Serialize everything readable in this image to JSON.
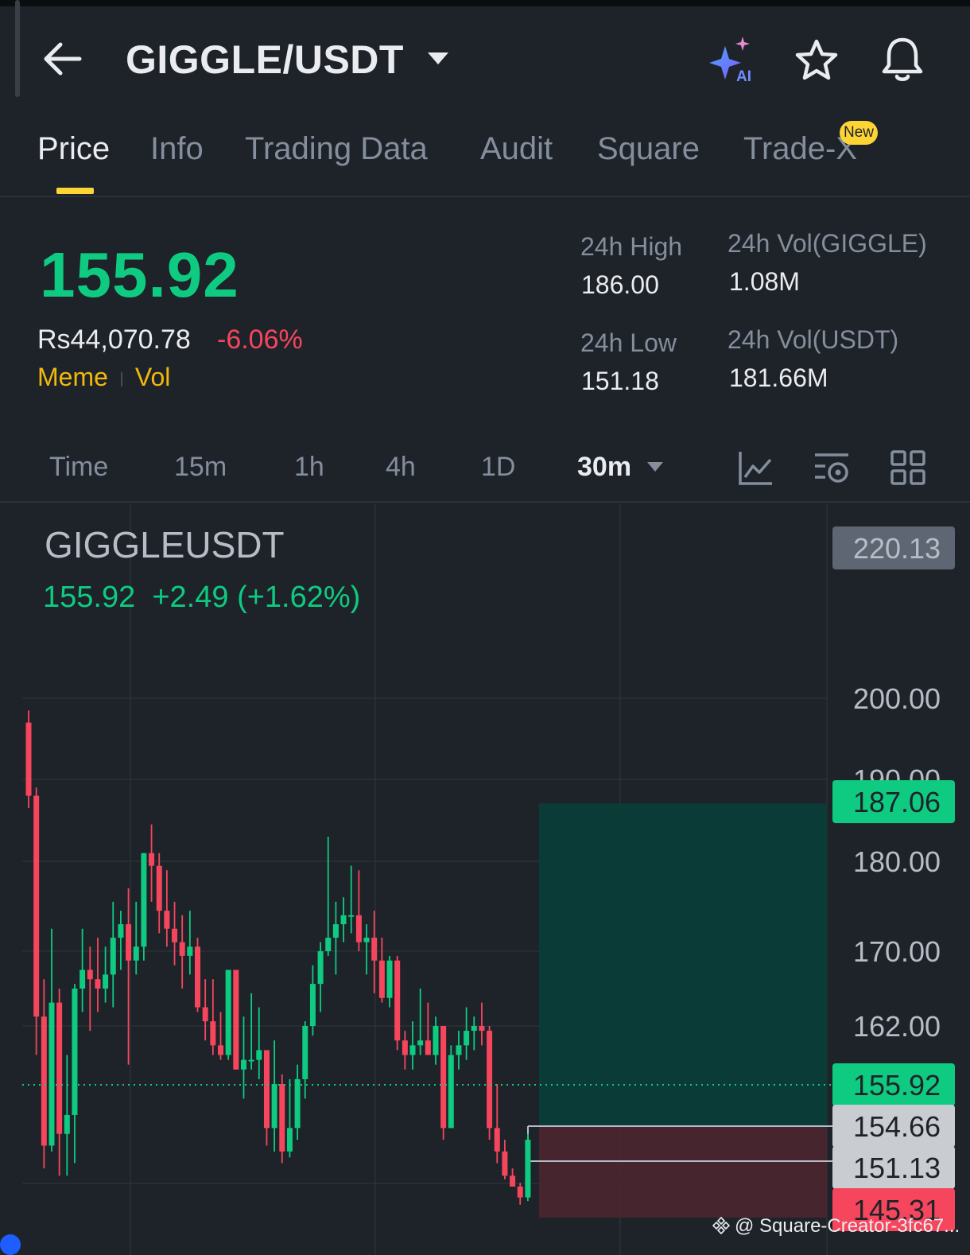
{
  "header": {
    "pair": "GIGGLE/USDT",
    "ai_label": "AI"
  },
  "tabs": [
    {
      "label": "Price",
      "active": true
    },
    {
      "label": "Info"
    },
    {
      "label": "Trading Data"
    },
    {
      "label": "Audit"
    },
    {
      "label": "Square"
    },
    {
      "label": "Trade-X",
      "badge": "New"
    }
  ],
  "ticker": {
    "last_price": "155.92",
    "fiat_price": "Rs44,070.78",
    "change_pct": "-6.06%",
    "tags": [
      "Meme",
      "Vol"
    ],
    "high_label": "24h High",
    "high_value": "186.00",
    "low_label": "24h Low",
    "low_value": "151.18",
    "vol_base_label": "24h Vol(GIGGLE)",
    "vol_base_value": "1.08M",
    "vol_quote_label": "24h Vol(USDT)",
    "vol_quote_value": "181.66M"
  },
  "intervals": {
    "items": [
      "Time",
      "15m",
      "1h",
      "4h",
      "1D"
    ],
    "active": "30m"
  },
  "chart": {
    "symbol": "GIGGLEUSDT",
    "last": "155.92",
    "change": "+2.49 (+1.62%)"
  },
  "watermark": "@ Square-Creator-3fc67...",
  "colors": {
    "background": "#1e2329",
    "up": "#0ecb81",
    "down": "#f6465d",
    "accent": "#fcd535",
    "muted": "#848e9c"
  },
  "chart_data": {
    "type": "candlestick",
    "interval": "30m",
    "y_axis_labels": [
      "220.13",
      "200.00",
      "190.00",
      "180.00",
      "170.00",
      "162.00"
    ],
    "price_tags": [
      {
        "label": "187.06",
        "kind": "take-profit",
        "color": "#0ecb81"
      },
      {
        "label": "155.92",
        "kind": "last-price",
        "color": "#0ecb81"
      },
      {
        "label": "154.66",
        "kind": "entry",
        "color": "#c9ccd1"
      },
      {
        "label": "151.13",
        "kind": "level",
        "color": "#c9ccd1"
      },
      {
        "label": "145.31",
        "kind": "stop-loss",
        "color": "#f6465d"
      }
    ],
    "position_zone": {
      "entry": 154.66,
      "take_profit": 187.06,
      "stop_loss": 145.31
    },
    "candles": [
      [
        197.0,
        198.5,
        186.5,
        188.0
      ],
      [
        188.0,
        189.0,
        159.0,
        163.0
      ],
      [
        163.0,
        167.0,
        151.0,
        153.0
      ],
      [
        153.0,
        172.5,
        152.5,
        164.5
      ],
      [
        164.5,
        166.0,
        150.0,
        154.0
      ],
      [
        154.0,
        159.0,
        150.0,
        155.0
      ],
      [
        155.0,
        166.5,
        151.5,
        166.0
      ],
      [
        166.0,
        172.5,
        163.5,
        168.0
      ],
      [
        168.0,
        170.5,
        161.5,
        167.0
      ],
      [
        167.0,
        171.5,
        163.5,
        166.0
      ],
      [
        166.0,
        170.5,
        164.5,
        167.5
      ],
      [
        167.5,
        175.5,
        164.0,
        171.5
      ],
      [
        171.5,
        174.5,
        168.0,
        173.0
      ],
      [
        173.0,
        177.0,
        158.0,
        169.0
      ],
      [
        169.0,
        175.5,
        167.5,
        170.5
      ],
      [
        170.5,
        181.0,
        169.0,
        181.0
      ],
      [
        181.0,
        184.5,
        175.5,
        179.5
      ],
      [
        179.5,
        181.0,
        172.0,
        174.5
      ],
      [
        174.5,
        179.0,
        170.5,
        172.5
      ],
      [
        172.5,
        175.5,
        168.5,
        171.0
      ],
      [
        171.0,
        174.0,
        166.0,
        169.5
      ],
      [
        169.5,
        174.5,
        167.5,
        170.5
      ],
      [
        170.5,
        171.5,
        163.5,
        164.0
      ],
      [
        164.0,
        167.0,
        160.5,
        162.5
      ],
      [
        162.5,
        167.0,
        159.0,
        160.0
      ],
      [
        160.0,
        163.5,
        158.5,
        159.0
      ],
      [
        159.0,
        168.0,
        158.5,
        168.0
      ],
      [
        168.0,
        168.0,
        157.5,
        157.5
      ],
      [
        157.5,
        163.0,
        155.5,
        158.5
      ],
      [
        158.5,
        165.5,
        157.5,
        158.5
      ],
      [
        158.5,
        164.0,
        156.5,
        159.5
      ],
      [
        159.5,
        159.5,
        153.0,
        154.5
      ],
      [
        154.5,
        160.5,
        152.5,
        156.0
      ],
      [
        156.0,
        157.0,
        151.5,
        152.5
      ],
      [
        152.5,
        156.5,
        152.0,
        154.5
      ],
      [
        154.5,
        158.0,
        153.5,
        156.5
      ],
      [
        156.5,
        162.5,
        155.5,
        162.0
      ],
      [
        162.0,
        168.5,
        161.0,
        166.5
      ],
      [
        166.5,
        171.0,
        163.5,
        170.0
      ],
      [
        170.0,
        183.0,
        169.5,
        171.5
      ],
      [
        171.5,
        175.5,
        167.5,
        173.0
      ],
      [
        173.0,
        176.0,
        171.0,
        174.0
      ],
      [
        174.0,
        179.5,
        172.0,
        174.0
      ],
      [
        174.0,
        179.0,
        170.0,
        171.0
      ],
      [
        171.0,
        173.0,
        167.5,
        171.5
      ],
      [
        171.5,
        174.5,
        165.5,
        169.0
      ],
      [
        169.0,
        171.5,
        164.5,
        165.0
      ],
      [
        165.0,
        169.5,
        164.0,
        169.0
      ],
      [
        169.0,
        169.5,
        159.5,
        160.5
      ],
      [
        160.5,
        161.5,
        157.5,
        159.0
      ],
      [
        159.0,
        162.5,
        157.5,
        160.0
      ],
      [
        160.0,
        166.0,
        159.0,
        160.5
      ],
      [
        160.5,
        164.5,
        159.0,
        159.0
      ],
      [
        159.0,
        163.0,
        158.0,
        162.0
      ],
      [
        162.0,
        162.0,
        153.5,
        154.5
      ],
      [
        154.5,
        160.0,
        154.5,
        159.0
      ],
      [
        159.0,
        161.5,
        157.5,
        160.0
      ],
      [
        160.0,
        164.0,
        158.5,
        161.5
      ],
      [
        161.5,
        163.0,
        159.5,
        162.0
      ],
      [
        162.0,
        164.5,
        160.0,
        161.5
      ],
      [
        161.5,
        162.0,
        153.5,
        154.5
      ],
      [
        154.5,
        156.0,
        151.5,
        152.5
      ],
      [
        152.5,
        153.5,
        149.5,
        150.0
      ],
      [
        150.0,
        151.0,
        148.5,
        148.5
      ],
      [
        148.5,
        149.0,
        146.0,
        147.0
      ],
      [
        147.0,
        154.0,
        146.5,
        153.5
      ]
    ]
  }
}
